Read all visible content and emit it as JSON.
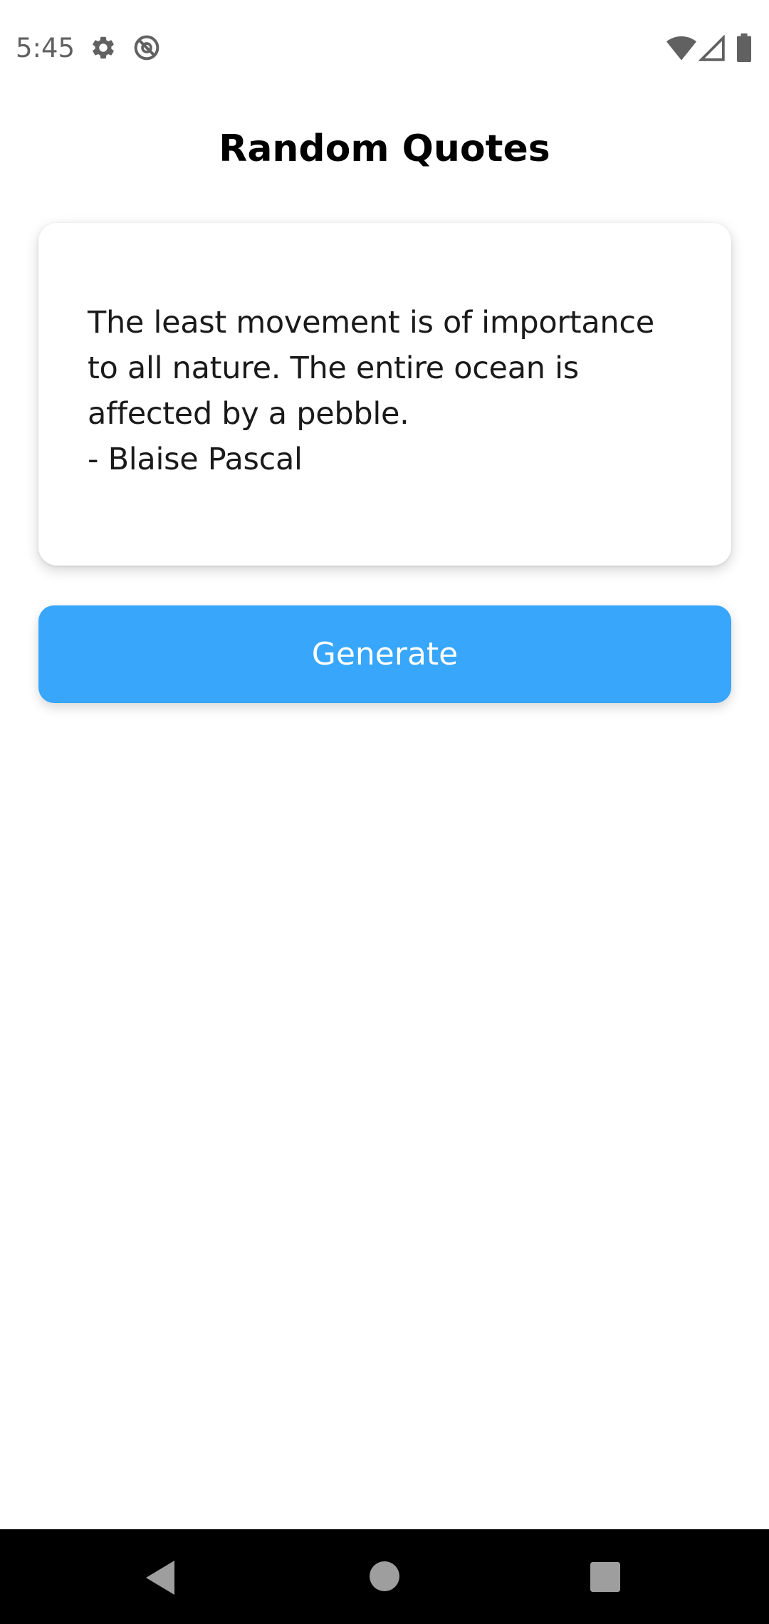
{
  "status_bar": {
    "time": "5:45",
    "icons": {
      "left": [
        "settings-gear-icon",
        "do-not-disturb-icon"
      ],
      "right": [
        "wifi-icon",
        "cellular-signal-icon",
        "battery-icon"
      ]
    }
  },
  "app": {
    "title": "Random Quotes"
  },
  "quote": {
    "text_line_1": "The least movement is of importance",
    "text_line_2": "to all nature. The entire ocean is",
    "text_line_3": "affected by a pebble.",
    "author_line": "- Blaise Pascal"
  },
  "actions": {
    "generate_label": "Generate"
  },
  "navigation": {
    "icons": [
      "back-icon",
      "home-icon",
      "recents-icon"
    ]
  },
  "colors": {
    "accent": "#37a6fb",
    "background": "#ffffff",
    "nav_bar": "#000000",
    "status_text": "#616161"
  }
}
